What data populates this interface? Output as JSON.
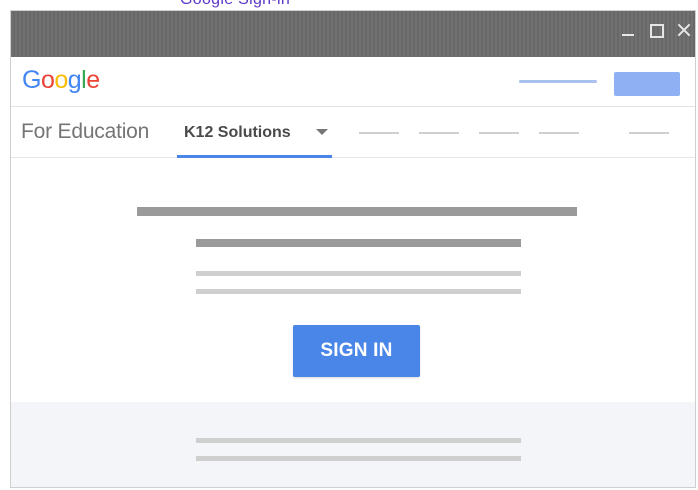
{
  "top_fragment": {
    "text": "Google Sign-in"
  },
  "window": {
    "controls": [
      "minimize",
      "maximize",
      "close"
    ]
  },
  "header": {
    "logo_letters": [
      "G",
      "o",
      "o",
      "g",
      "l",
      "e"
    ],
    "button_label": ""
  },
  "nav": {
    "brand": "For Education",
    "active_tab": "K12 Solutions",
    "menu_items": [
      "",
      "",
      "",
      "",
      ""
    ]
  },
  "content": {
    "signin_label": "SIGN IN"
  },
  "colors": {
    "titlebar": "#6b6b6b",
    "accent_blue": "#4a86e8",
    "header_button": "#8fb0f3",
    "footer_bg": "#f4f5f8",
    "google_blue": "#4285f4",
    "google_red": "#ea4335",
    "google_yellow": "#fbbc05",
    "google_green": "#34a853"
  }
}
